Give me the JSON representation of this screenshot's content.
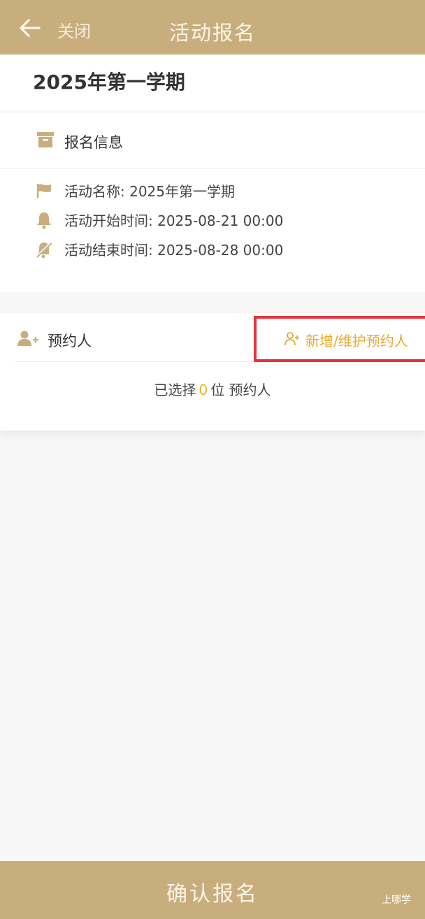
{
  "header": {
    "close_label": "关闭",
    "title": "活动报名"
  },
  "term": {
    "title": "2025年第一学期"
  },
  "info": {
    "section_label": "报名信息",
    "rows": [
      {
        "icon": "flag-icon",
        "text": "活动名称: 2025年第一学期"
      },
      {
        "icon": "bell-icon",
        "text": "活动开始时间: 2025-08-21 00:00"
      },
      {
        "icon": "bell-off-icon",
        "text": "活动结束时间: 2025-08-28 00:00"
      }
    ]
  },
  "people": {
    "section_label": "预约人",
    "add_label": "新增/维护预约人",
    "selected_prefix": "已选择",
    "selected_count": "0",
    "selected_suffix": "位 预约人"
  },
  "footer": {
    "confirm_label": "确认报名",
    "watermark": "上哪学"
  },
  "colors": {
    "brand": "#c9ae7d",
    "accent": "#f0b323",
    "highlight_border": "#e8333c"
  }
}
